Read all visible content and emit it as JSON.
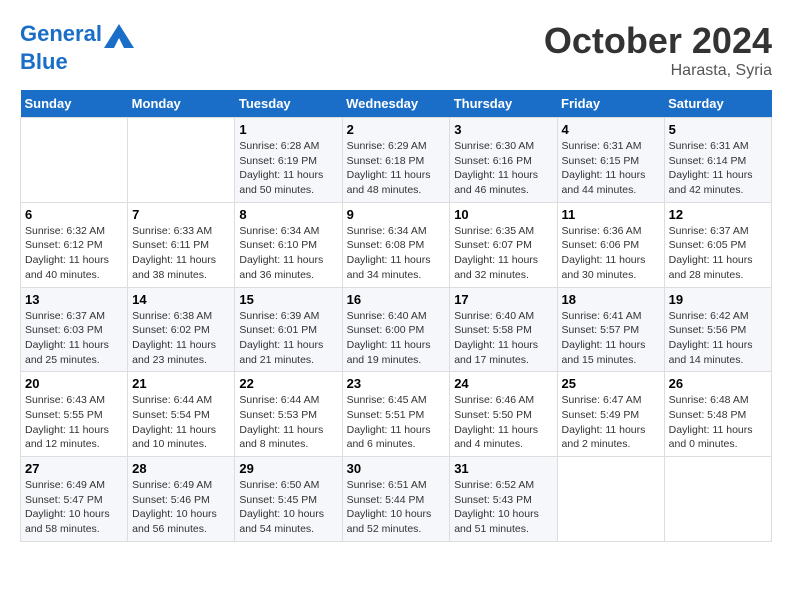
{
  "header": {
    "logo_line1": "General",
    "logo_line2": "Blue",
    "month": "October 2024",
    "location": "Harasta, Syria"
  },
  "days_of_week": [
    "Sunday",
    "Monday",
    "Tuesday",
    "Wednesday",
    "Thursday",
    "Friday",
    "Saturday"
  ],
  "weeks": [
    [
      {
        "day": "",
        "detail": ""
      },
      {
        "day": "",
        "detail": ""
      },
      {
        "day": "1",
        "detail": "Sunrise: 6:28 AM\nSunset: 6:19 PM\nDaylight: 11 hours and 50 minutes."
      },
      {
        "day": "2",
        "detail": "Sunrise: 6:29 AM\nSunset: 6:18 PM\nDaylight: 11 hours and 48 minutes."
      },
      {
        "day": "3",
        "detail": "Sunrise: 6:30 AM\nSunset: 6:16 PM\nDaylight: 11 hours and 46 minutes."
      },
      {
        "day": "4",
        "detail": "Sunrise: 6:31 AM\nSunset: 6:15 PM\nDaylight: 11 hours and 44 minutes."
      },
      {
        "day": "5",
        "detail": "Sunrise: 6:31 AM\nSunset: 6:14 PM\nDaylight: 11 hours and 42 minutes."
      }
    ],
    [
      {
        "day": "6",
        "detail": "Sunrise: 6:32 AM\nSunset: 6:12 PM\nDaylight: 11 hours and 40 minutes."
      },
      {
        "day": "7",
        "detail": "Sunrise: 6:33 AM\nSunset: 6:11 PM\nDaylight: 11 hours and 38 minutes."
      },
      {
        "day": "8",
        "detail": "Sunrise: 6:34 AM\nSunset: 6:10 PM\nDaylight: 11 hours and 36 minutes."
      },
      {
        "day": "9",
        "detail": "Sunrise: 6:34 AM\nSunset: 6:08 PM\nDaylight: 11 hours and 34 minutes."
      },
      {
        "day": "10",
        "detail": "Sunrise: 6:35 AM\nSunset: 6:07 PM\nDaylight: 11 hours and 32 minutes."
      },
      {
        "day": "11",
        "detail": "Sunrise: 6:36 AM\nSunset: 6:06 PM\nDaylight: 11 hours and 30 minutes."
      },
      {
        "day": "12",
        "detail": "Sunrise: 6:37 AM\nSunset: 6:05 PM\nDaylight: 11 hours and 28 minutes."
      }
    ],
    [
      {
        "day": "13",
        "detail": "Sunrise: 6:37 AM\nSunset: 6:03 PM\nDaylight: 11 hours and 25 minutes."
      },
      {
        "day": "14",
        "detail": "Sunrise: 6:38 AM\nSunset: 6:02 PM\nDaylight: 11 hours and 23 minutes."
      },
      {
        "day": "15",
        "detail": "Sunrise: 6:39 AM\nSunset: 6:01 PM\nDaylight: 11 hours and 21 minutes."
      },
      {
        "day": "16",
        "detail": "Sunrise: 6:40 AM\nSunset: 6:00 PM\nDaylight: 11 hours and 19 minutes."
      },
      {
        "day": "17",
        "detail": "Sunrise: 6:40 AM\nSunset: 5:58 PM\nDaylight: 11 hours and 17 minutes."
      },
      {
        "day": "18",
        "detail": "Sunrise: 6:41 AM\nSunset: 5:57 PM\nDaylight: 11 hours and 15 minutes."
      },
      {
        "day": "19",
        "detail": "Sunrise: 6:42 AM\nSunset: 5:56 PM\nDaylight: 11 hours and 14 minutes."
      }
    ],
    [
      {
        "day": "20",
        "detail": "Sunrise: 6:43 AM\nSunset: 5:55 PM\nDaylight: 11 hours and 12 minutes."
      },
      {
        "day": "21",
        "detail": "Sunrise: 6:44 AM\nSunset: 5:54 PM\nDaylight: 11 hours and 10 minutes."
      },
      {
        "day": "22",
        "detail": "Sunrise: 6:44 AM\nSunset: 5:53 PM\nDaylight: 11 hours and 8 minutes."
      },
      {
        "day": "23",
        "detail": "Sunrise: 6:45 AM\nSunset: 5:51 PM\nDaylight: 11 hours and 6 minutes."
      },
      {
        "day": "24",
        "detail": "Sunrise: 6:46 AM\nSunset: 5:50 PM\nDaylight: 11 hours and 4 minutes."
      },
      {
        "day": "25",
        "detail": "Sunrise: 6:47 AM\nSunset: 5:49 PM\nDaylight: 11 hours and 2 minutes."
      },
      {
        "day": "26",
        "detail": "Sunrise: 6:48 AM\nSunset: 5:48 PM\nDaylight: 11 hours and 0 minutes."
      }
    ],
    [
      {
        "day": "27",
        "detail": "Sunrise: 6:49 AM\nSunset: 5:47 PM\nDaylight: 10 hours and 58 minutes."
      },
      {
        "day": "28",
        "detail": "Sunrise: 6:49 AM\nSunset: 5:46 PM\nDaylight: 10 hours and 56 minutes."
      },
      {
        "day": "29",
        "detail": "Sunrise: 6:50 AM\nSunset: 5:45 PM\nDaylight: 10 hours and 54 minutes."
      },
      {
        "day": "30",
        "detail": "Sunrise: 6:51 AM\nSunset: 5:44 PM\nDaylight: 10 hours and 52 minutes."
      },
      {
        "day": "31",
        "detail": "Sunrise: 6:52 AM\nSunset: 5:43 PM\nDaylight: 10 hours and 51 minutes."
      },
      {
        "day": "",
        "detail": ""
      },
      {
        "day": "",
        "detail": ""
      }
    ]
  ]
}
